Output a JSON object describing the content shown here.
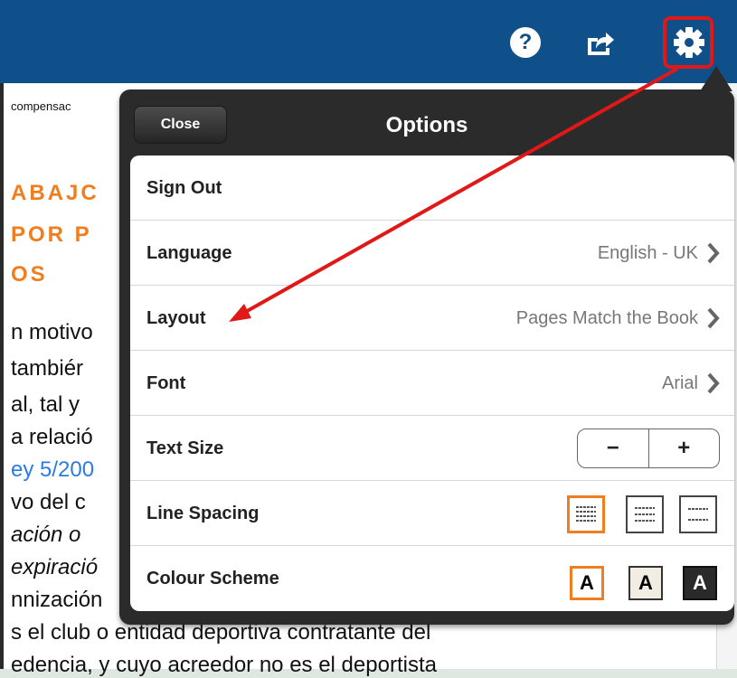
{
  "toolbar": {
    "help_icon": "help-icon",
    "share_icon": "share-icon",
    "settings_icon": "gear-icon",
    "help_glyph": "?"
  },
  "document": {
    "snippet_top": "compensac",
    "heading": [
      "ABAJC",
      "POR P",
      "OS"
    ],
    "lines": [
      "n motivo",
      " tambiér",
      "al, tal y",
      "a relació",
      "ey 5/200",
      "vo del c",
      "ación o",
      "expiració",
      "nnización",
      "s el club o entidad deportiva contratante del",
      "edencia, y cuyo acreedor no es el deportista"
    ]
  },
  "options": {
    "close_label": "Close",
    "title": "Options",
    "rows": [
      {
        "label": "Sign Out",
        "value": ""
      },
      {
        "label": "Language",
        "value": "English - UK"
      },
      {
        "label": "Layout",
        "value": "Pages Match the Book"
      },
      {
        "label": "Font",
        "value": "Arial"
      },
      {
        "label": "Text Size",
        "value": ""
      },
      {
        "label": "Line Spacing",
        "value": ""
      },
      {
        "label": "Colour Scheme",
        "value": ""
      }
    ],
    "text_size": {
      "minus": "−",
      "plus": "+"
    },
    "colour_scheme": [
      "A",
      "A",
      "A"
    ]
  },
  "colors": {
    "topbar": "#0f4f8a",
    "accent_orange": "#f07e1f",
    "annotation_red": "#e01818"
  }
}
